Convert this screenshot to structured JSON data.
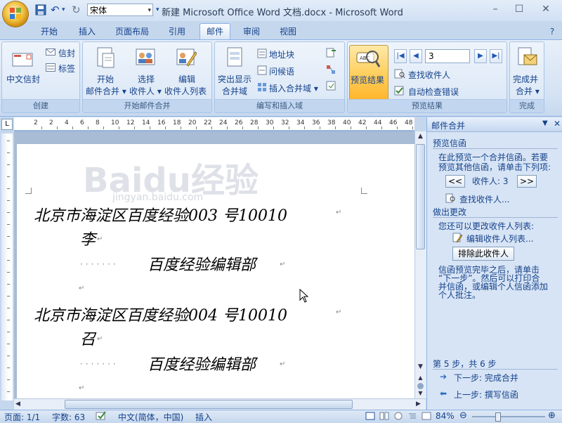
{
  "window": {
    "title": "新建 Microsoft Office Word 文档.docx - Microsoft Word",
    "font_box": "宋体",
    "controls": [
      "–",
      "☐",
      "✕"
    ]
  },
  "tabs": [
    "开始",
    "插入",
    "页面布局",
    "引用",
    "邮件",
    "审阅",
    "视图"
  ],
  "active_tab": "邮件",
  "ribbon": {
    "groups": {
      "create": "创建",
      "start_merge": "开始邮件合并",
      "write_insert": "编写和插入域",
      "preview": "预览结果",
      "finish": "完成"
    },
    "create": {
      "envelopes": "中文信封",
      "envelope": "信封",
      "labels": "标签"
    },
    "start_merge": {
      "start_1": "开始",
      "start_2": "邮件合并",
      "select_1": "选择",
      "select_2": "收件人",
      "edit_1": "编辑",
      "edit_2": "收件人列表"
    },
    "write_insert": {
      "highlight_1": "突出显示",
      "highlight_2": "合并域",
      "address_block": "地址块",
      "greeting_line": "问候语",
      "insert_field": "插入合并域"
    },
    "preview": {
      "preview_results": "预览结果",
      "record": "3",
      "find_recipient": "查找收件人",
      "auto_check": "自动检查错误"
    },
    "finish": {
      "finish_1": "完成并",
      "finish_2": "合并"
    }
  },
  "ruler": {
    "corner": "L",
    "ticks": [
      "2",
      "2",
      "4",
      "6",
      "8",
      "10",
      "12",
      "14",
      "16",
      "18",
      "20",
      "22",
      "24",
      "26",
      "28",
      "30",
      "32",
      "34",
      "36",
      "38",
      "40",
      "42",
      "44",
      "46",
      "48"
    ]
  },
  "document": {
    "lines": [
      "北京市海淀区百度经验003  号10010",
      "李",
      "百度经验编辑部",
      "北京市海淀区百度经验004  号10010",
      "召",
      "百度经验编辑部"
    ],
    "watermark": "Baidu经验",
    "watermark_sub": "jingyan.baidu.com"
  },
  "task_pane": {
    "title": "邮件合并",
    "preview_heading": "预览信函",
    "preview_desc_1": "在此预览一个合并信函。若要",
    "preview_desc_2": "预览其他信函，请单击下列项:",
    "prev_btn": "<<",
    "recipient_label": "收件人: 3",
    "next_btn": ">>",
    "find_recipient": "查找收件人...",
    "changes_heading": "做出更改",
    "changes_desc": "您还可以更改收件人列表:",
    "edit_list": "编辑收件人列表...",
    "exclude_btn": "排除此收件人",
    "finish_desc_1": "信函预览完毕之后，请单击",
    "finish_desc_2": "“下一步”。然后可以打印合",
    "finish_desc_3": "并信函，或编辑个人信函添加",
    "finish_desc_4": "个人批注。",
    "step": "第 5 步，共 6 步",
    "next_step": "下一步: 完成合并",
    "prev_step": "上一步: 撰写信函"
  },
  "status_bar": {
    "page": "页面: 1/1",
    "words": "字数: 63",
    "language": "中文(简体，中国)",
    "mode": "插入",
    "zoom": "84%"
  }
}
